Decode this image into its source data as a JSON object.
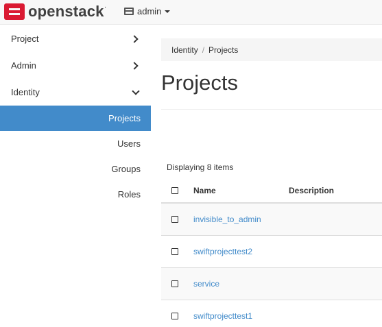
{
  "brand": {
    "name": "openstack",
    "tm": "."
  },
  "user_menu": {
    "label": "admin"
  },
  "sidebar": {
    "sections": [
      {
        "label": "Project",
        "expanded": false
      },
      {
        "label": "Admin",
        "expanded": false
      },
      {
        "label": "Identity",
        "expanded": true
      }
    ],
    "items": [
      {
        "label": "Projects",
        "active": true
      },
      {
        "label": "Users",
        "active": false
      },
      {
        "label": "Groups",
        "active": false
      },
      {
        "label": "Roles",
        "active": false
      }
    ]
  },
  "breadcrumb": {
    "items": [
      "Identity",
      "Projects"
    ],
    "separator": "/"
  },
  "page": {
    "title": "Projects",
    "count_text": "Displaying 8 items"
  },
  "table": {
    "columns": [
      "Name",
      "Description"
    ],
    "rows": [
      {
        "name": "invisible_to_admin",
        "description": ""
      },
      {
        "name": "swiftprojecttest2",
        "description": ""
      },
      {
        "name": "service",
        "description": ""
      },
      {
        "name": "swiftprojecttest1",
        "description": ""
      }
    ]
  },
  "colors": {
    "accent": "#428bca",
    "brand": "#da1a32",
    "navbar": "#f8f8f8"
  }
}
